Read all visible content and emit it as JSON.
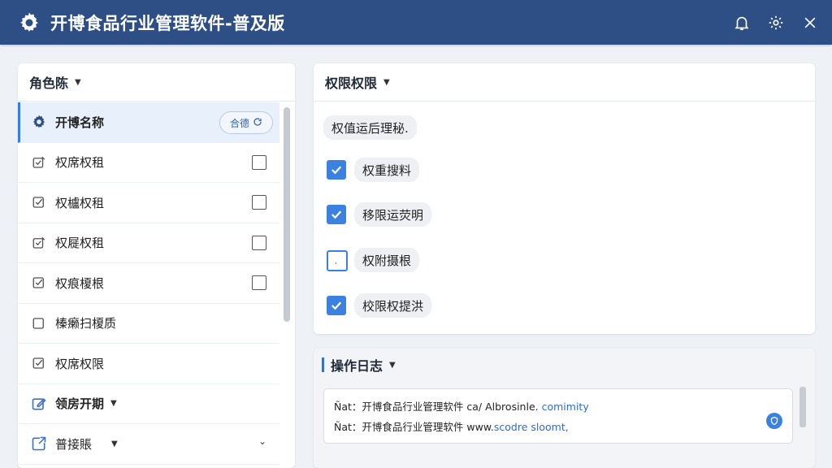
{
  "window": {
    "title": "开博食品行业管理软件-普及版",
    "icons": [
      "gear-logo-icon",
      "bell-icon",
      "settings-icon",
      "close-icon"
    ]
  },
  "roles_panel": {
    "header": "角色陈",
    "items": [
      {
        "label": "开博名称",
        "icon": "gear-icon",
        "selected": true,
        "pill": "合德"
      },
      {
        "label": "权席权租",
        "icon": "checkbox-edit-icon",
        "checkbox": false
      },
      {
        "label": "权櫨权租",
        "icon": "checkbox-check-icon",
        "checkbox": false
      },
      {
        "label": "权屣权租",
        "icon": "checkbox-edit-icon",
        "checkbox": false
      },
      {
        "label": "权痕榎根",
        "icon": "checkbox-check-icon",
        "checkbox": false
      },
      {
        "label": "榛癞扫榎质",
        "icon": "checkbox-empty-icon"
      },
      {
        "label": "权席权限",
        "icon": "checkbox-check-icon"
      },
      {
        "label": "领房开期",
        "icon": "edit-icon",
        "caret": true
      },
      {
        "label": "普接賬",
        "icon": "export-icon",
        "chevron": true
      }
    ]
  },
  "perm_panel": {
    "header": "权限权限",
    "subtitle": "权值运后理秘.",
    "options": [
      {
        "label": "权重搜料",
        "checked": true
      },
      {
        "label": "移限运荧明",
        "checked": true
      },
      {
        "label": "权附摄根",
        "checked": false
      },
      {
        "label": "校限权提洪",
        "checked": true
      }
    ]
  },
  "log_panel": {
    "header": "操作日志",
    "lines": [
      {
        "prefix": "Ñat：开博食品行业管理软件 ca/ Albrosinle.",
        "link": " comimity"
      },
      {
        "prefix": "Ñat：开博食品行业管理软件 www.",
        "link": "scodre sloomt,"
      }
    ]
  },
  "colors": {
    "titlebar": "#2e4f86",
    "accent": "#3b82e0",
    "background": "#eef1f6"
  }
}
